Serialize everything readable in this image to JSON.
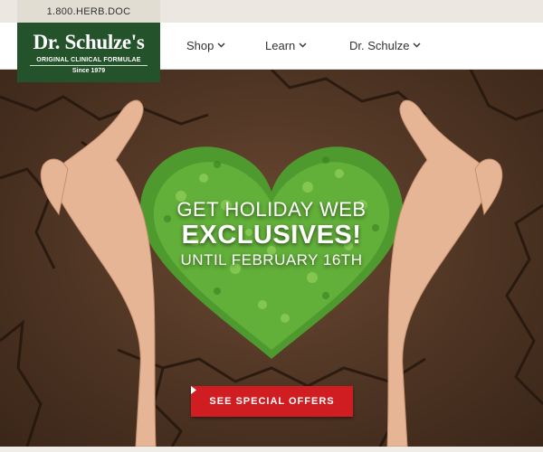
{
  "header": {
    "phone": "1.800.HERB.DOC",
    "logo": {
      "name": "Dr. Schulze's",
      "tagline": "ORIGINAL CLINICAL FORMULAE",
      "since": "Since 1979"
    },
    "nav": [
      {
        "label": "Shop",
        "icon": "chevron-down-icon"
      },
      {
        "label": "Learn",
        "icon": "chevron-down-icon"
      },
      {
        "label": "Dr. Schulze",
        "icon": "chevron-down-icon"
      }
    ]
  },
  "hero": {
    "line1": "GET HOLIDAY WEB",
    "line2": "EXCLUSIVES!",
    "line3": "UNTIL FEBRUARY 16TH",
    "cta_label": "SEE SPECIAL OFFERS",
    "cta_icon": "caret-right-icon"
  },
  "colors": {
    "brand_green": "#24522a",
    "cta_red": "#d01d21",
    "soil_brown": "#4e3423",
    "leaf_green": "#5aa235"
  }
}
